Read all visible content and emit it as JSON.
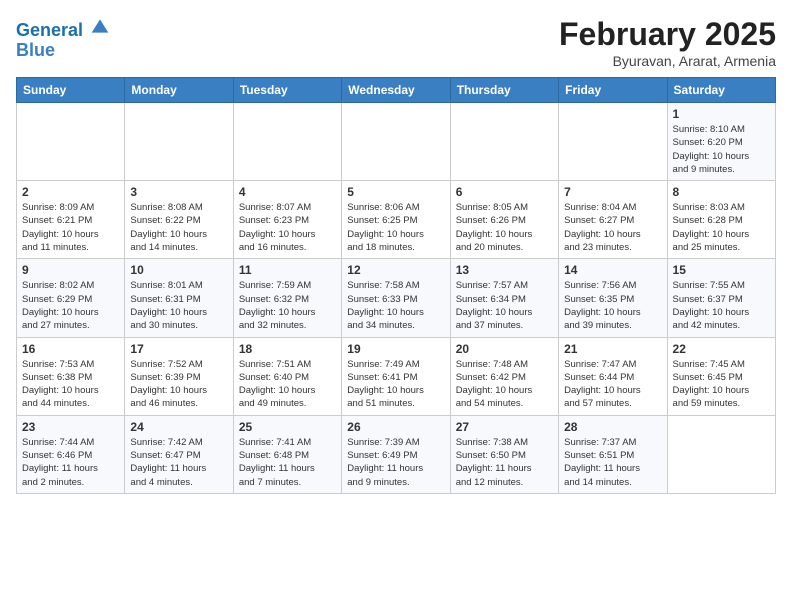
{
  "header": {
    "logo_line1": "General",
    "logo_line2": "Blue",
    "month_title": "February 2025",
    "location": "Byuravan, Ararat, Armenia"
  },
  "weekdays": [
    "Sunday",
    "Monday",
    "Tuesday",
    "Wednesday",
    "Thursday",
    "Friday",
    "Saturday"
  ],
  "weeks": [
    [
      {
        "day": "",
        "info": ""
      },
      {
        "day": "",
        "info": ""
      },
      {
        "day": "",
        "info": ""
      },
      {
        "day": "",
        "info": ""
      },
      {
        "day": "",
        "info": ""
      },
      {
        "day": "",
        "info": ""
      },
      {
        "day": "1",
        "info": "Sunrise: 8:10 AM\nSunset: 6:20 PM\nDaylight: 10 hours\nand 9 minutes."
      }
    ],
    [
      {
        "day": "2",
        "info": "Sunrise: 8:09 AM\nSunset: 6:21 PM\nDaylight: 10 hours\nand 11 minutes."
      },
      {
        "day": "3",
        "info": "Sunrise: 8:08 AM\nSunset: 6:22 PM\nDaylight: 10 hours\nand 14 minutes."
      },
      {
        "day": "4",
        "info": "Sunrise: 8:07 AM\nSunset: 6:23 PM\nDaylight: 10 hours\nand 16 minutes."
      },
      {
        "day": "5",
        "info": "Sunrise: 8:06 AM\nSunset: 6:25 PM\nDaylight: 10 hours\nand 18 minutes."
      },
      {
        "day": "6",
        "info": "Sunrise: 8:05 AM\nSunset: 6:26 PM\nDaylight: 10 hours\nand 20 minutes."
      },
      {
        "day": "7",
        "info": "Sunrise: 8:04 AM\nSunset: 6:27 PM\nDaylight: 10 hours\nand 23 minutes."
      },
      {
        "day": "8",
        "info": "Sunrise: 8:03 AM\nSunset: 6:28 PM\nDaylight: 10 hours\nand 25 minutes."
      }
    ],
    [
      {
        "day": "9",
        "info": "Sunrise: 8:02 AM\nSunset: 6:29 PM\nDaylight: 10 hours\nand 27 minutes."
      },
      {
        "day": "10",
        "info": "Sunrise: 8:01 AM\nSunset: 6:31 PM\nDaylight: 10 hours\nand 30 minutes."
      },
      {
        "day": "11",
        "info": "Sunrise: 7:59 AM\nSunset: 6:32 PM\nDaylight: 10 hours\nand 32 minutes."
      },
      {
        "day": "12",
        "info": "Sunrise: 7:58 AM\nSunset: 6:33 PM\nDaylight: 10 hours\nand 34 minutes."
      },
      {
        "day": "13",
        "info": "Sunrise: 7:57 AM\nSunset: 6:34 PM\nDaylight: 10 hours\nand 37 minutes."
      },
      {
        "day": "14",
        "info": "Sunrise: 7:56 AM\nSunset: 6:35 PM\nDaylight: 10 hours\nand 39 minutes."
      },
      {
        "day": "15",
        "info": "Sunrise: 7:55 AM\nSunset: 6:37 PM\nDaylight: 10 hours\nand 42 minutes."
      }
    ],
    [
      {
        "day": "16",
        "info": "Sunrise: 7:53 AM\nSunset: 6:38 PM\nDaylight: 10 hours\nand 44 minutes."
      },
      {
        "day": "17",
        "info": "Sunrise: 7:52 AM\nSunset: 6:39 PM\nDaylight: 10 hours\nand 46 minutes."
      },
      {
        "day": "18",
        "info": "Sunrise: 7:51 AM\nSunset: 6:40 PM\nDaylight: 10 hours\nand 49 minutes."
      },
      {
        "day": "19",
        "info": "Sunrise: 7:49 AM\nSunset: 6:41 PM\nDaylight: 10 hours\nand 51 minutes."
      },
      {
        "day": "20",
        "info": "Sunrise: 7:48 AM\nSunset: 6:42 PM\nDaylight: 10 hours\nand 54 minutes."
      },
      {
        "day": "21",
        "info": "Sunrise: 7:47 AM\nSunset: 6:44 PM\nDaylight: 10 hours\nand 57 minutes."
      },
      {
        "day": "22",
        "info": "Sunrise: 7:45 AM\nSunset: 6:45 PM\nDaylight: 10 hours\nand 59 minutes."
      }
    ],
    [
      {
        "day": "23",
        "info": "Sunrise: 7:44 AM\nSunset: 6:46 PM\nDaylight: 11 hours\nand 2 minutes."
      },
      {
        "day": "24",
        "info": "Sunrise: 7:42 AM\nSunset: 6:47 PM\nDaylight: 11 hours\nand 4 minutes."
      },
      {
        "day": "25",
        "info": "Sunrise: 7:41 AM\nSunset: 6:48 PM\nDaylight: 11 hours\nand 7 minutes."
      },
      {
        "day": "26",
        "info": "Sunrise: 7:39 AM\nSunset: 6:49 PM\nDaylight: 11 hours\nand 9 minutes."
      },
      {
        "day": "27",
        "info": "Sunrise: 7:38 AM\nSunset: 6:50 PM\nDaylight: 11 hours\nand 12 minutes."
      },
      {
        "day": "28",
        "info": "Sunrise: 7:37 AM\nSunset: 6:51 PM\nDaylight: 11 hours\nand 14 minutes."
      },
      {
        "day": "",
        "info": ""
      }
    ]
  ]
}
